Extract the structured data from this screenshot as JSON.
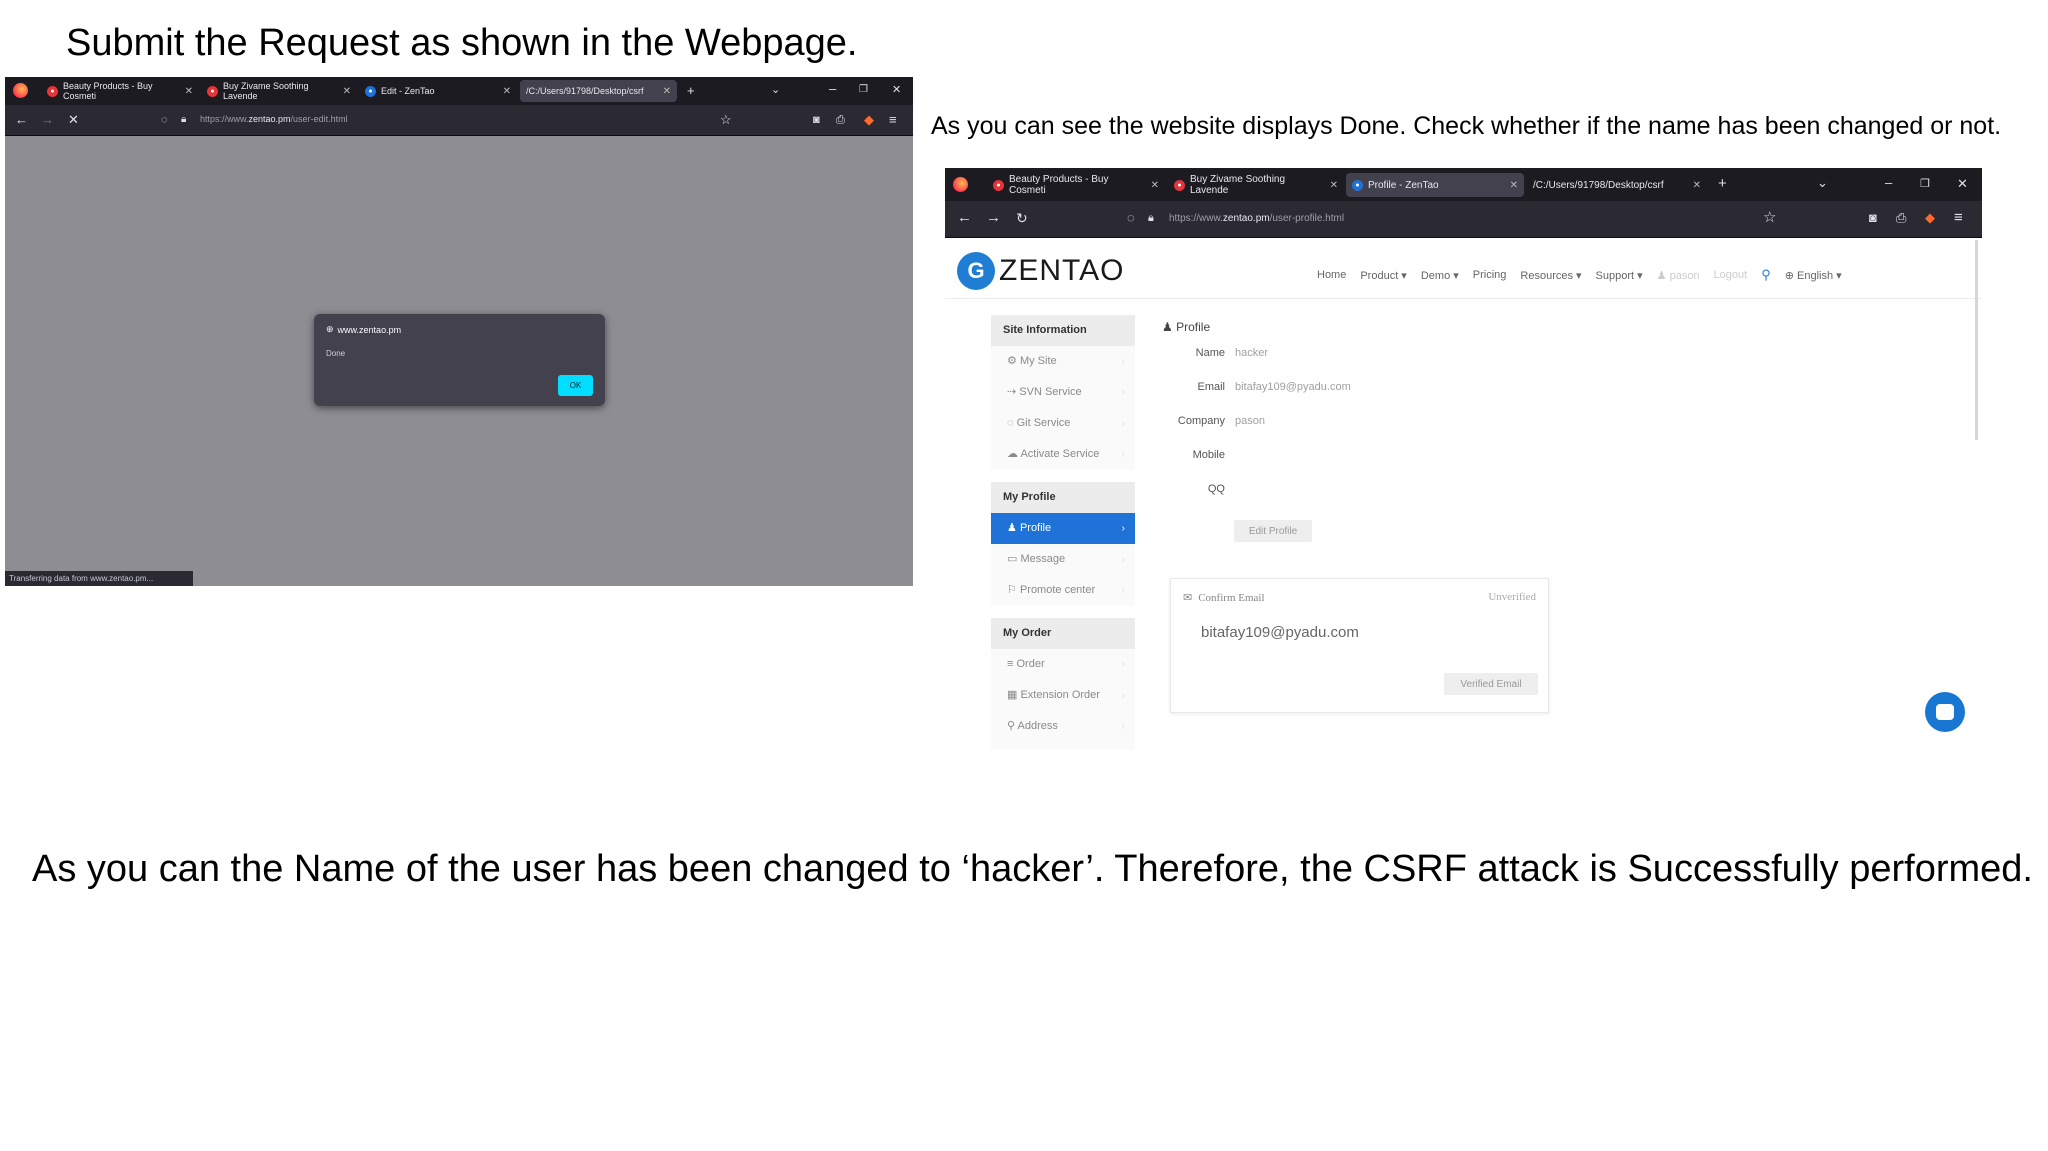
{
  "captions": {
    "top": "Submit the Request as shown in the Webpage.",
    "right": "As you can see the website displays Done. Check whether if the name has been changed or not.",
    "bottom": "As you can the Name of the user has been changed to ‘hacker’. Therefore, the CSRF attack is Successfully performed."
  },
  "shot1": {
    "tabs": [
      {
        "label": "Beauty Products - Buy Cosmeti"
      },
      {
        "label": "Buy Zivame Soothing Lavende"
      },
      {
        "label": "Edit - ZenTao"
      },
      {
        "label": "/C:/Users/91798/Desktop/csrf"
      }
    ],
    "url_prefix": "https://www.",
    "url_host": "zentao.pm",
    "url_path": "/user-edit.html",
    "dialog": {
      "host": "www.zentao.pm",
      "message": "Done",
      "ok_label": "OK"
    },
    "status": "Transferring data from www.zentao.pm..."
  },
  "shot2": {
    "tabs": [
      {
        "label": "Beauty Products - Buy Cosmeti"
      },
      {
        "label": "Buy Zivame Soothing Lavende"
      },
      {
        "label": "Profile - ZenTao"
      },
      {
        "label": "/C:/Users/91798/Desktop/csrf"
      }
    ],
    "url_prefix": "https://www.",
    "url_host": "zentao.pm",
    "url_path": "/user-profile.html",
    "logo_text": "ZENTAO",
    "nav": {
      "home": "Home",
      "product": "Product ▾",
      "demo": "Demo ▾",
      "pricing": "Pricing",
      "resources": "Resources ▾",
      "support": "Support ▾",
      "user": "pason",
      "logout": "Logout",
      "language": "English ▾"
    },
    "sidebar": {
      "site_info": "Site Information",
      "my_site": "My Site",
      "svn": "SVN Service",
      "git": "Git Service",
      "activate": "Activate Service",
      "my_profile": "My Profile",
      "profile": "Profile",
      "message": "Message",
      "promote": "Promote center",
      "my_order": "My Order",
      "order": "Order",
      "extension_order": "Extension Order",
      "address": "Address"
    },
    "profile": {
      "title": "Profile",
      "name_label": "Name",
      "name_value": "hacker",
      "email_label": "Email",
      "email_value": "bitafay109@pyadu.com",
      "company_label": "Company",
      "company_value": "pason",
      "mobile_label": "Mobile",
      "qq_label": "QQ",
      "edit_label": "Edit Profile"
    },
    "confirm": {
      "title": "Confirm Email",
      "status": "Unverified",
      "email": "bitafay109@pyadu.com",
      "button": "Verified Email"
    }
  },
  "colors": {
    "accent_blue": "#1f72d8",
    "dialog_ok": "#00ddff",
    "browser_dark": "#1c1b22"
  }
}
